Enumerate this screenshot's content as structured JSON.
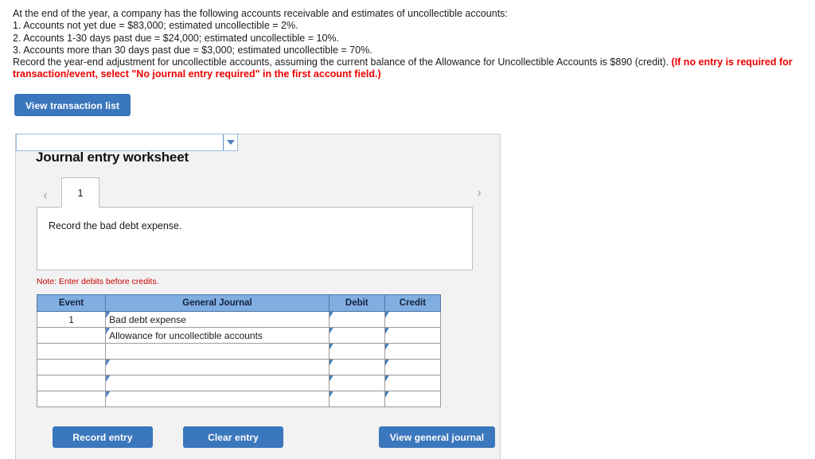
{
  "problem": {
    "lines": [
      "At the end of the year, a company has the following accounts receivable and estimates of uncollectible accounts:",
      "1. Accounts not yet due = $83,000; estimated uncollectible = 2%.",
      "2. Accounts 1-30 days past due = $24,000; estimated uncollectible = 10%.",
      "3. Accounts more than 30 days past due = $3,000; estimated uncollectible = 70%."
    ],
    "record_line_black": "Record the year-end adjustment for uncollectible accounts, assuming the current balance of the Allowance for Uncollectible Accounts is $890 (credit). ",
    "record_line_red": "(If no entry is required for",
    "record_line_red2": "transaction/event, select \"No journal entry required\" in the first account field.)"
  },
  "toolbar": {
    "view_transaction_list_label": "View transaction list"
  },
  "worksheet": {
    "title": "Journal entry worksheet",
    "prev_arrow": "‹",
    "next_arrow": "›",
    "tabs": [
      {
        "label": "1",
        "active": true
      }
    ],
    "prompt": "Record the bad debt expense.",
    "note": "Note: Enter debits before credits."
  },
  "journal_table": {
    "columns": [
      "Event",
      "General Journal",
      "Debit",
      "Credit"
    ],
    "rows": [
      {
        "event": "1",
        "account": "Bad debt expense",
        "debit": "",
        "credit": "",
        "state": "filled"
      },
      {
        "event": "",
        "account": "Allowance for uncollectible accounts",
        "debit": "",
        "credit": "",
        "state": "filled"
      },
      {
        "event": "",
        "account": "",
        "debit": "",
        "credit": "",
        "state": "focused-dropdown"
      },
      {
        "event": "",
        "account": "",
        "debit": "",
        "credit": "",
        "state": "empty"
      },
      {
        "event": "",
        "account": "",
        "debit": "",
        "credit": "",
        "state": "empty"
      },
      {
        "event": "",
        "account": "",
        "debit": "",
        "credit": "",
        "state": "empty"
      }
    ]
  },
  "footer": {
    "record_entry_label": "Record entry",
    "clear_entry_label": "Clear entry",
    "view_general_journal_label": "View general journal"
  },
  "colors": {
    "button_blue": "#3b77bc",
    "table_header_blue": "#80aee0",
    "cell_border_blue": "#5b8fc7",
    "note_red": "#cc0000",
    "instruction_red": "#ee0000",
    "panel_background": "#f2f2f2"
  }
}
